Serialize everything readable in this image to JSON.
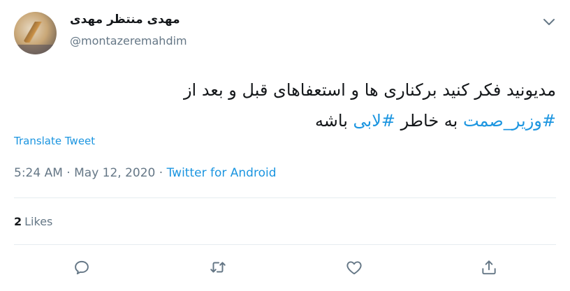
{
  "user": {
    "display_name": "مهدی منتظر مهدی",
    "handle": "@montazeremahdim"
  },
  "tweet": {
    "line1": "مدیونید فکر کنید برکناری ها و استعفاهای قبل و بعد از",
    "hashtag1": "#وزیر_صمت",
    "line2_mid": " به خاطر ",
    "hashtag2": "#لابی",
    "line2_end": " باشه"
  },
  "translate_label": "Translate Tweet",
  "meta": {
    "time": "5:24 AM",
    "sep1": " · ",
    "date": "May 12, 2020",
    "sep2": " · ",
    "source": "Twitter for Android"
  },
  "stats": {
    "likes_count": "2",
    "likes_label": "Likes"
  },
  "icons": [
    "chevron-down-icon",
    "reply-icon",
    "retweet-icon",
    "like-icon",
    "share-icon"
  ],
  "colors": {
    "link": "#1b95e0",
    "secondary": "#657786",
    "divider": "#e6ecf0",
    "text": "#14171a"
  }
}
